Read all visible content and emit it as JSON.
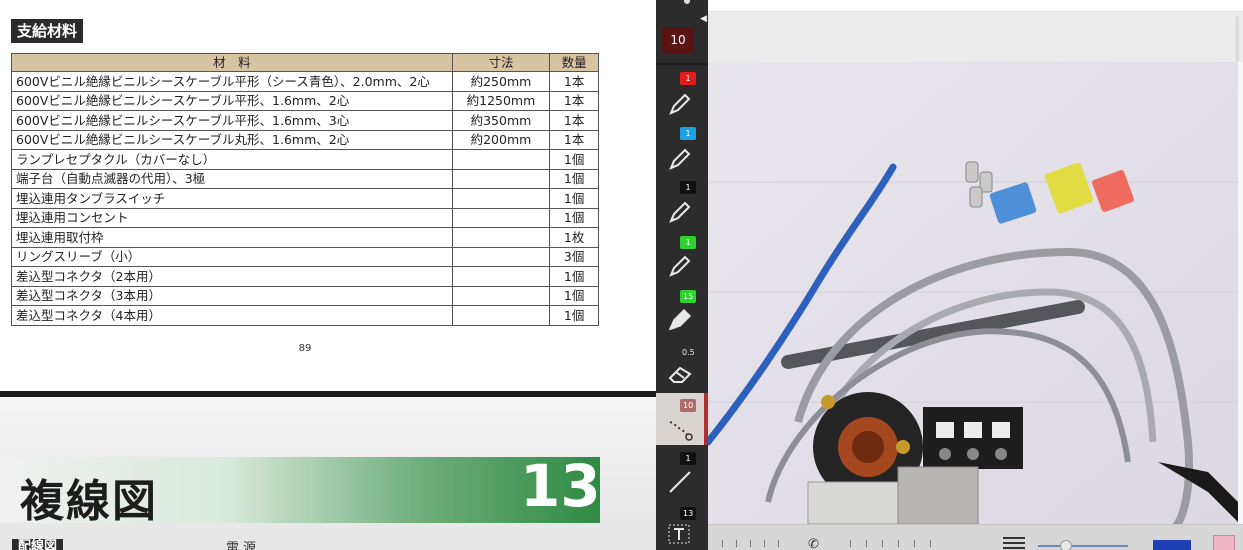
{
  "document": {
    "section_title": "支給材料",
    "table": {
      "headers": [
        "材　料",
        "寸法",
        "数量"
      ],
      "rows": [
        [
          "600Vビニル絶縁ビニルシースケーブル平形（シース青色）、2.0mm、2心",
          "約250mm",
          "1本"
        ],
        [
          "600Vビニル絶縁ビニルシースケーブル平形、1.6mm、2心",
          "約1250mm",
          "1本"
        ],
        [
          "600Vビニル絶縁ビニルシースケーブル平形、1.6mm、3心",
          "約350mm",
          "1本"
        ],
        [
          "600Vビニル絶縁ビニルシースケーブル丸形、1.6mm、2心",
          "約200mm",
          "1本"
        ],
        [
          "ランプレセプタクル（カバーなし）",
          "",
          "1個"
        ],
        [
          "端子台（自動点滅器の代用）、3極",
          "",
          "1個"
        ],
        [
          "埋込連用タンブラスイッチ",
          "",
          "1個"
        ],
        [
          "埋込連用コンセント",
          "",
          "1個"
        ],
        [
          "埋込連用取付枠",
          "",
          "1枚"
        ],
        [
          "リングスリーブ（小）",
          "",
          "3個"
        ],
        [
          "差込型コネクタ（2本用）",
          "",
          "1個"
        ],
        [
          "差込型コネクタ（3本用）",
          "",
          "1個"
        ],
        [
          "差込型コネクタ（4本用）",
          "",
          "1個"
        ]
      ]
    },
    "page_number": "89",
    "chapter_title": "複線図",
    "chapter_number": "13",
    "sub_label_wiring": "配線図",
    "sub_label_power": "電源"
  },
  "toolbar": {
    "size_indicator": "10",
    "tools": [
      {
        "badge": "1",
        "badge_color": "#e31b1b",
        "icon": "pen-icon"
      },
      {
        "badge": "1",
        "badge_color": "#1ba3e3",
        "icon": "pen-icon"
      },
      {
        "badge": "1",
        "badge_color": "#111111",
        "icon": "pen-icon"
      },
      {
        "badge": "1",
        "badge_color": "#2fd12f",
        "icon": "pen-icon"
      },
      {
        "badge": "15",
        "badge_color": "#2fd12f",
        "icon": "highlighter-icon"
      },
      {
        "badge": "0.5",
        "badge_color": "transparent",
        "icon": "eraser-icon"
      },
      {
        "badge": "10",
        "badge_color": "#b06b6b",
        "icon": "laser-pointer-icon"
      },
      {
        "badge": "1",
        "badge_color": "#111111",
        "icon": "line-icon"
      },
      {
        "badge": "13",
        "badge_color": "#111111",
        "icon": "text-tool-icon"
      }
    ]
  },
  "camera": {
    "bottom_bar_icons": [
      "phone-icon",
      "menu-icon",
      "zoom-slider",
      "blue-color-swatch",
      "pink-color-swatch"
    ]
  }
}
